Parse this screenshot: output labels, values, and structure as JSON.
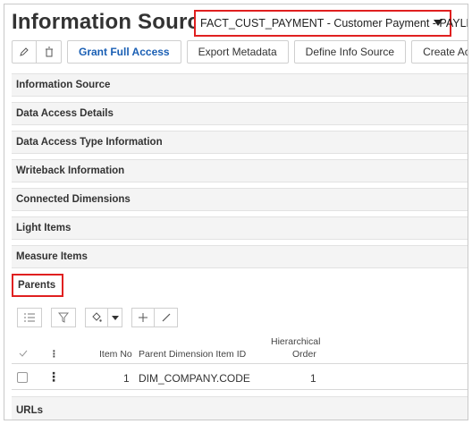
{
  "header": {
    "title": "Information Source",
    "selected_source": "FACT_CUST_PAYMENT - Customer Payment - PAYLED"
  },
  "toolbar": {
    "grant_label": "Grant Full Access",
    "export_label": "Export Metadata",
    "define_label": "Define Info Source",
    "create_label": "Create Access V"
  },
  "sections": [
    "Information Source",
    "Data Access Details",
    "Data Access Type Information",
    "Writeback Information",
    "Connected Dimensions",
    "Light Items",
    "Measure Items",
    "Parents"
  ],
  "grid": {
    "columns": {
      "item_no": "Item No",
      "parent_dim": "Parent Dimension Item ID",
      "hier_line1": "Hierarchical",
      "hier_line2": "Order"
    },
    "rows": [
      {
        "item_no": "1",
        "parent_dim": "DIM_COMPANY.CODE",
        "order": "1"
      }
    ]
  },
  "urls_section": "URLs",
  "colors": {
    "accent": "#1a5fb4",
    "highlight": "#e02020"
  },
  "icons": [
    "edit-icon",
    "delete-icon",
    "list-icon",
    "filter-icon",
    "bucket-icon",
    "add-icon",
    "pencil-icon",
    "kebab-icon",
    "check-icon",
    "caret-down-icon"
  ]
}
